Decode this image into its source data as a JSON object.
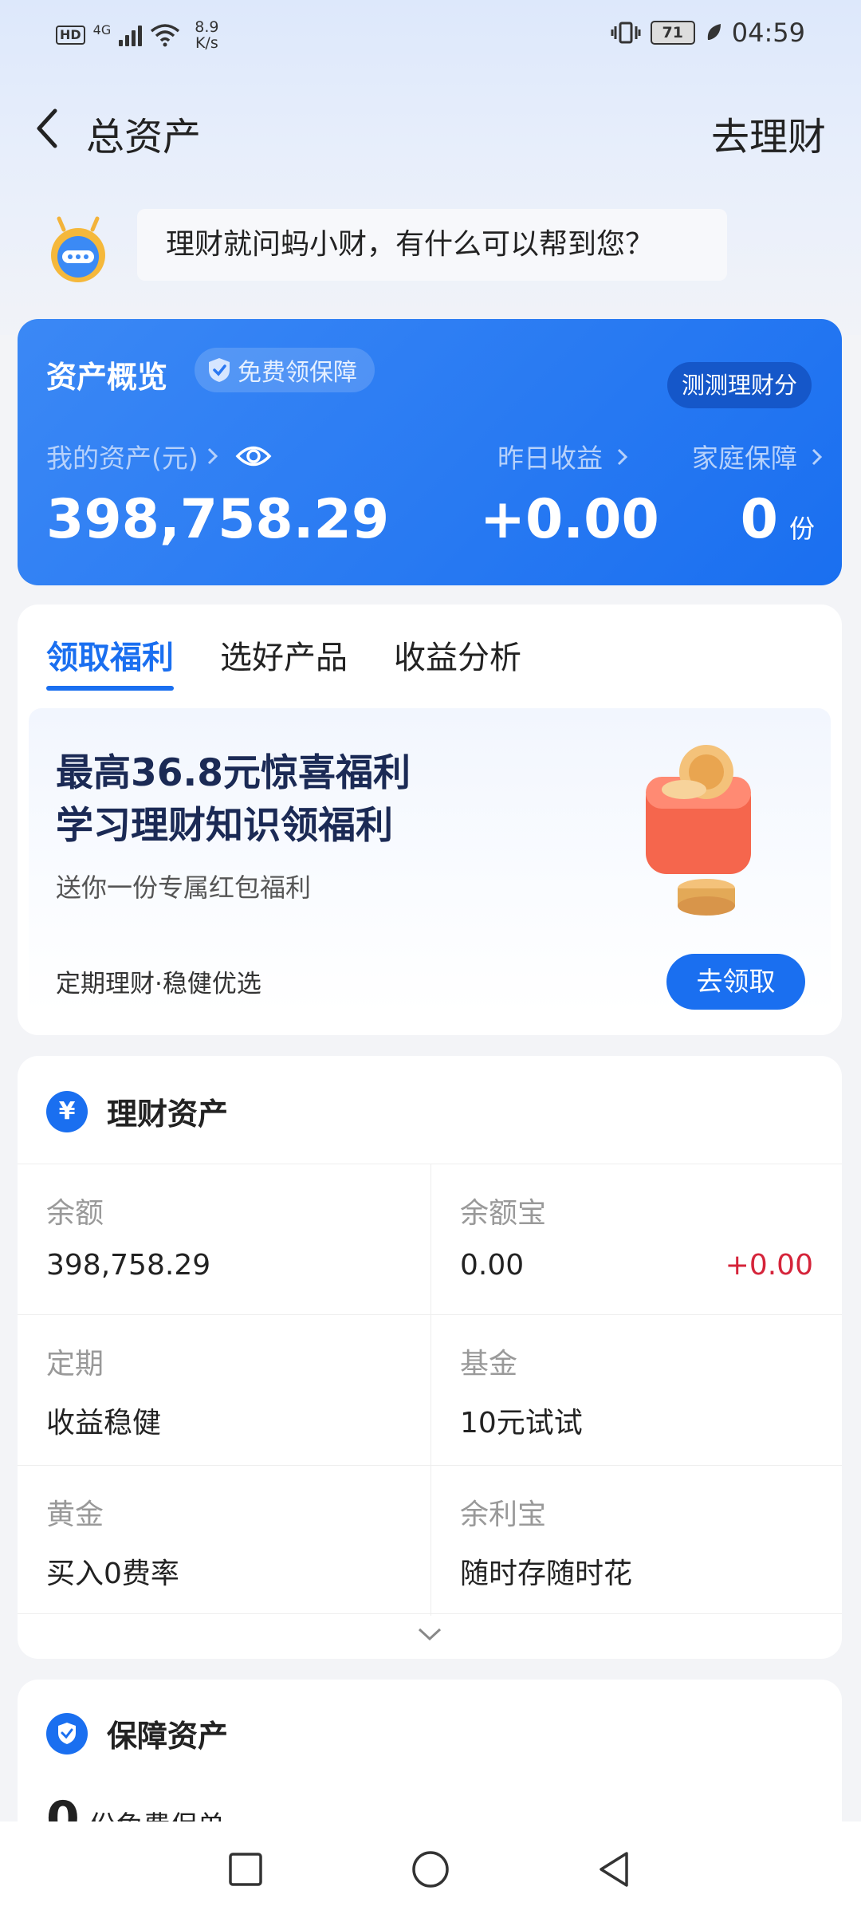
{
  "status_bar": {
    "hd": "HD",
    "net_type": "4G",
    "speed_value": "8.9",
    "speed_unit": "K/s",
    "battery": "71",
    "time": "04:59"
  },
  "header": {
    "title": "总资产",
    "right_action": "去理财"
  },
  "assistant": {
    "prompt": "理财就问蚂小财，有什么可以帮到您？"
  },
  "overview": {
    "title": "资产概览",
    "badge": "免费领保障",
    "score_button": "测测理财分",
    "my_assets_label": "我的资产(元)",
    "my_assets_value": "398,758.29",
    "yesterday_label": "昨日收益",
    "yesterday_value": "+0.00",
    "family_label": "家庭保障",
    "family_value": "0",
    "family_unit": "份"
  },
  "benefits": {
    "tabs": [
      {
        "label": "领取福利",
        "active": true
      },
      {
        "label": "选好产品",
        "active": false
      },
      {
        "label": "收益分析",
        "active": false
      }
    ],
    "promo_title_1": "最高36.8元惊喜福利",
    "promo_title_2": "学习理财知识领福利",
    "promo_sub": "送你一份专属红包福利",
    "promo_footer": "定期理财·稳健优选",
    "promo_button": "去领取"
  },
  "wealth_assets": {
    "title": "理财资产",
    "icon": "yen-icon",
    "items": [
      {
        "label": "余额",
        "value": "398,758.29",
        "change": ""
      },
      {
        "label": "余额宝",
        "value": "0.00",
        "change": "+0.00"
      },
      {
        "label": "定期",
        "value": "收益稳健",
        "change": ""
      },
      {
        "label": "基金",
        "value": "10元试试",
        "change": ""
      },
      {
        "label": "黄金",
        "value": "买入0费率",
        "change": ""
      },
      {
        "label": "余利宝",
        "value": "随时存随时花",
        "change": ""
      }
    ]
  },
  "protection": {
    "title": "保障资产",
    "count": "0",
    "count_text": "份免费保单"
  },
  "colors": {
    "accent": "#1a6ff0",
    "negative": "#d5243a"
  }
}
